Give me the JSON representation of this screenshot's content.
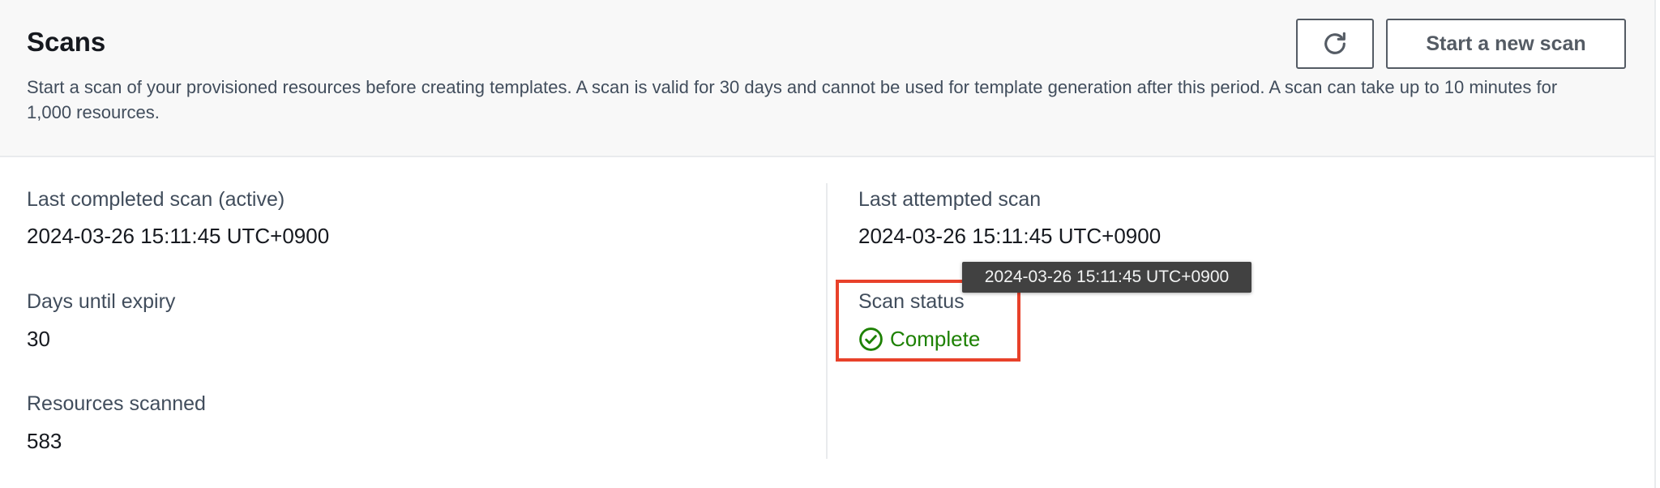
{
  "header": {
    "title": "Scans",
    "description": "Start a scan of your provisioned resources before creating templates. A scan is valid for 30 days and cannot be used for template generation after this period. A scan can take up to 10 minutes for 1,000 resources.",
    "refresh_icon": "refresh-icon",
    "start_new_scan_label": "Start a new scan"
  },
  "left_column": {
    "last_completed_label": "Last completed scan (active)",
    "last_completed_value": "2024-03-26 15:11:45 UTC+0900",
    "days_until_expiry_label": "Days until expiry",
    "days_until_expiry_value": "30",
    "resources_scanned_label": "Resources scanned",
    "resources_scanned_value": "583"
  },
  "right_column": {
    "last_attempted_label": "Last attempted scan",
    "last_attempted_value": "2024-03-26 15:11:45 UTC+0900",
    "scan_status_label": "Scan status",
    "scan_status_value": "Complete",
    "status_icon": "check-circle-icon"
  },
  "tooltip": {
    "text": "2024-03-26 15:11:45 UTC+0900"
  },
  "colors": {
    "success": "#1d8102",
    "highlight": "#e8412a",
    "tooltip_bg": "#414141"
  }
}
